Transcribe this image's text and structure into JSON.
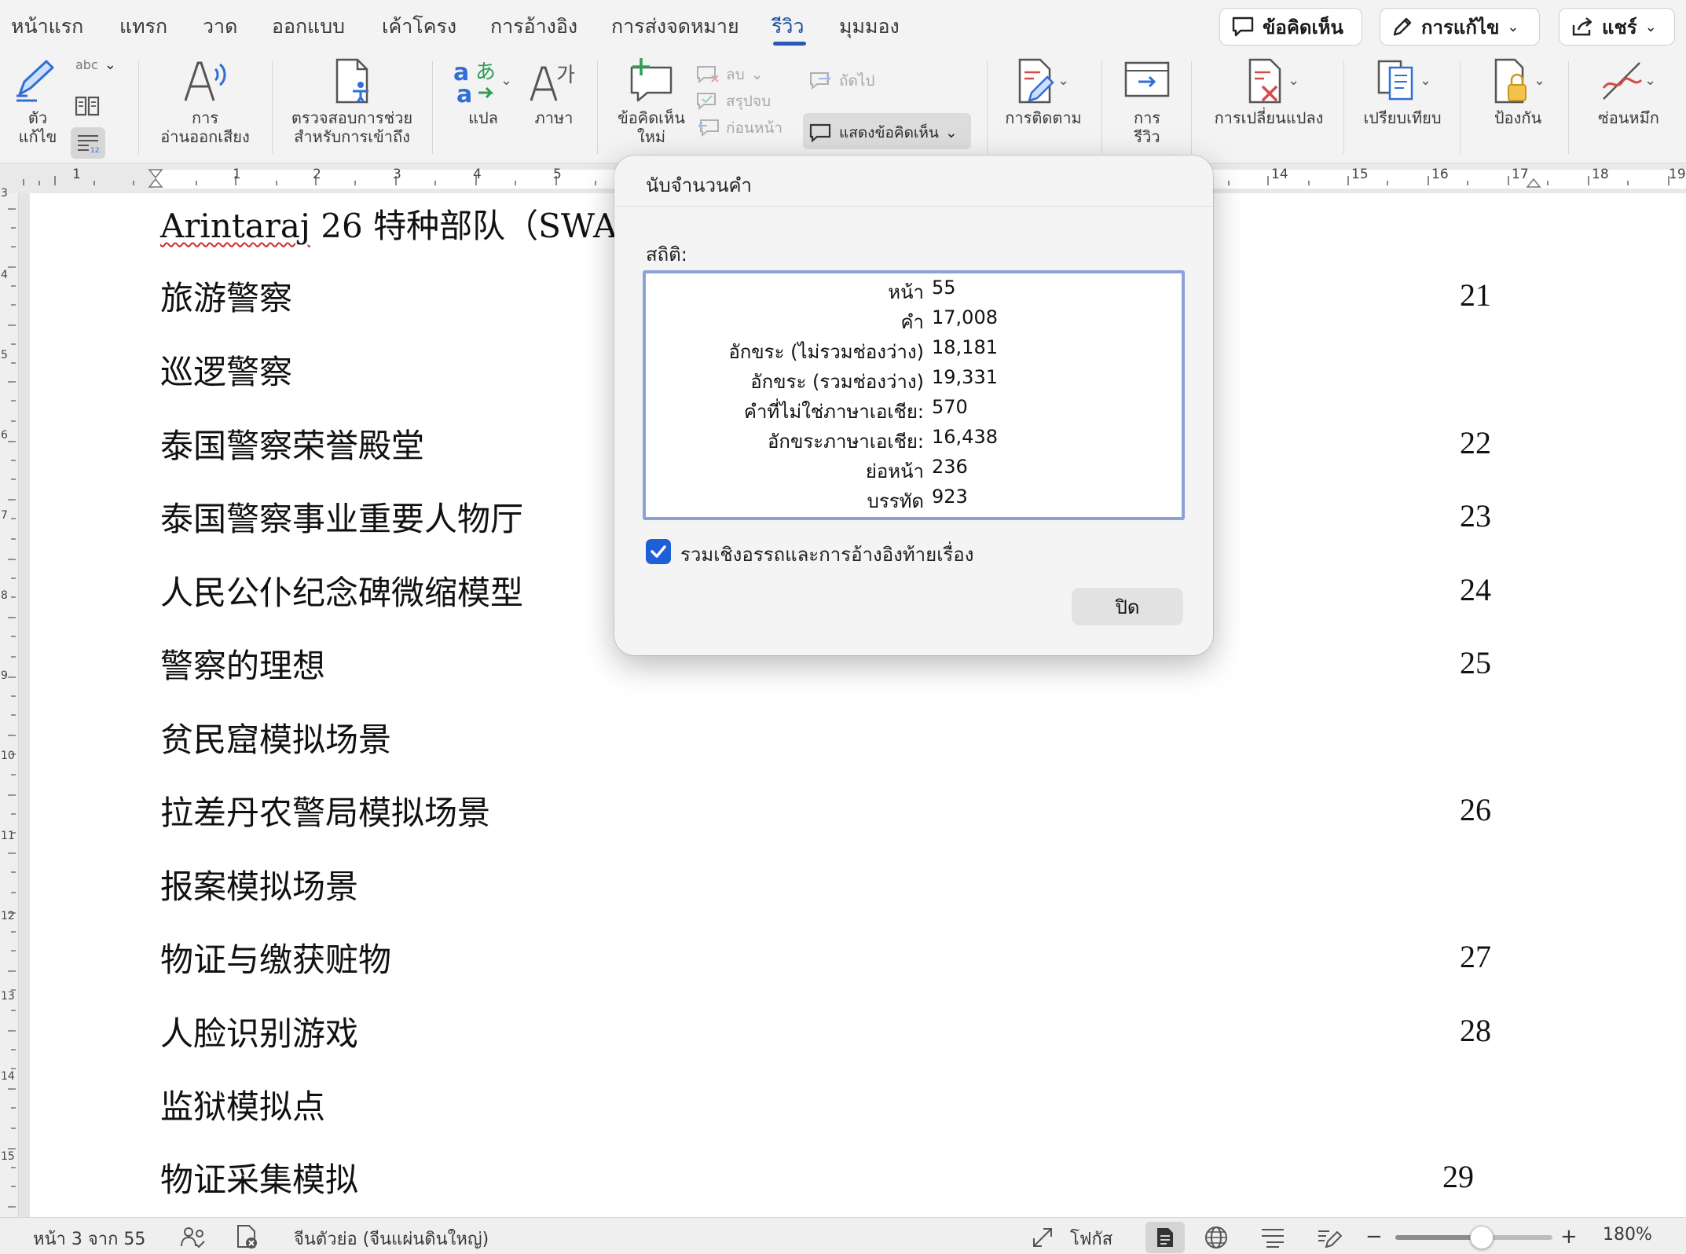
{
  "tabs": [
    {
      "label": "หน้าแรก",
      "active": false
    },
    {
      "label": "แทรก",
      "active": false
    },
    {
      "label": "วาด",
      "active": false
    },
    {
      "label": "ออกแบบ",
      "active": false
    },
    {
      "label": "เค้าโครง",
      "active": false
    },
    {
      "label": "การอ้างอิง",
      "active": false
    },
    {
      "label": "การส่งจดหมาย",
      "active": false
    },
    {
      "label": "รีวิว",
      "active": true
    },
    {
      "label": "มุมมอง",
      "active": false
    }
  ],
  "top_buttons": {
    "comments": "ข้อคิดเห็น",
    "editing": "การแก้ไข",
    "share": "แชร์"
  },
  "ribbon": {
    "spelling": {
      "line1": "ตัว",
      "line2": "แก้ไข",
      "abc": "abc"
    },
    "read_aloud": {
      "line1": "การ",
      "line2": "อ่านออกเสียง"
    },
    "accessibility": {
      "line1": "ตรวจสอบการช่วย",
      "line2": "สำหรับการเข้าถึง"
    },
    "translate": "แปล",
    "language": "ภาษา",
    "new_comment": {
      "line1": "ข้อคิดเห็น",
      "line2": "ใหม่"
    },
    "delete": "ลบ",
    "resolve": "สรุปจบ",
    "previous": "ก่อนหน้า",
    "next": "ถัดไป",
    "show_comments": "แสดงข้อคิดเห็น",
    "tracking": "การติดตาม",
    "reviewing": {
      "line1": "การ",
      "line2": "รีวิว"
    },
    "changes": "การเปลี่ยนแปลง",
    "compare": "เปรียบเทียบ",
    "protect": "ป้องกัน",
    "hide_ink": "ซ่อนหมึก"
  },
  "ruler_labels": {
    "left": [
      "1",
      "1",
      "2",
      "3",
      "4",
      "5"
    ],
    "right": [
      "14",
      "15",
      "16",
      "17",
      "18",
      "19"
    ],
    "vertical": [
      "3",
      "4",
      "5",
      "6",
      "7",
      "8",
      "9",
      "10",
      "11",
      "12",
      "13",
      "14",
      "15"
    ]
  },
  "document": {
    "first_line": {
      "latin": "Arintaraj",
      "rest": " 26  特种部队（SWAT）"
    },
    "lines": [
      {
        "text": "旅游警察",
        "page": "21"
      },
      {
        "text": "巡逻警察",
        "page": ""
      },
      {
        "text": "泰国警察荣誉殿堂",
        "page": "22"
      },
      {
        "text": "泰国警察事业重要人物厅",
        "page": "23"
      },
      {
        "text": "人民公仆纪念碑微缩模型",
        "page": "24"
      },
      {
        "text": "警察的理想",
        "page": "25"
      },
      {
        "text": "贫民窟模拟场景",
        "page": ""
      },
      {
        "text": "拉差丹农警局模拟场景",
        "page": "26"
      },
      {
        "text": "报案模拟场景",
        "page": ""
      },
      {
        "text": "物证与缴获赃物",
        "page": "27"
      },
      {
        "text": "人脸识别游戏",
        "page": "28"
      },
      {
        "text": "监狱模拟点",
        "page": ""
      },
      {
        "text": "物证采集模拟",
        "page": "29"
      }
    ]
  },
  "dialog": {
    "title": "นับจำนวนคำ",
    "stats_label": "สถิติ:",
    "stats": [
      {
        "label": "หน้า",
        "value": "55"
      },
      {
        "label": "คำ",
        "value": "17,008"
      },
      {
        "label": "อักขระ (ไม่รวมช่องว่าง)",
        "value": "18,181"
      },
      {
        "label": "อักขระ (รวมช่องว่าง)",
        "value": "19,331"
      },
      {
        "label": "คำที่ไม่ใช่ภาษาเอเชีย:",
        "value": "570"
      },
      {
        "label": "อักขระภาษาเอเชีย:",
        "value": "16,438"
      },
      {
        "label": "ย่อหน้า",
        "value": "236"
      },
      {
        "label": "บรรทัด",
        "value": "923"
      }
    ],
    "include_footnotes_label": "รวมเชิงอรรถและการอ้างอิงท้ายเรื่อง",
    "include_footnotes_checked": true,
    "close_label": "ปิด"
  },
  "status": {
    "page_info": "หน้า 3 จาก 55",
    "language": "จีนตัวย่อ (จีนแผ่นดินใหญ่)",
    "focus": "โฟกัส",
    "zoom": "180%",
    "zoom_level_fraction": 0.55
  },
  "colors": {
    "accent": "#2b57b8",
    "checkbox": "#1f5fd6",
    "stats_border": "#8aa2d6",
    "spell_error": "#d62b2b"
  }
}
